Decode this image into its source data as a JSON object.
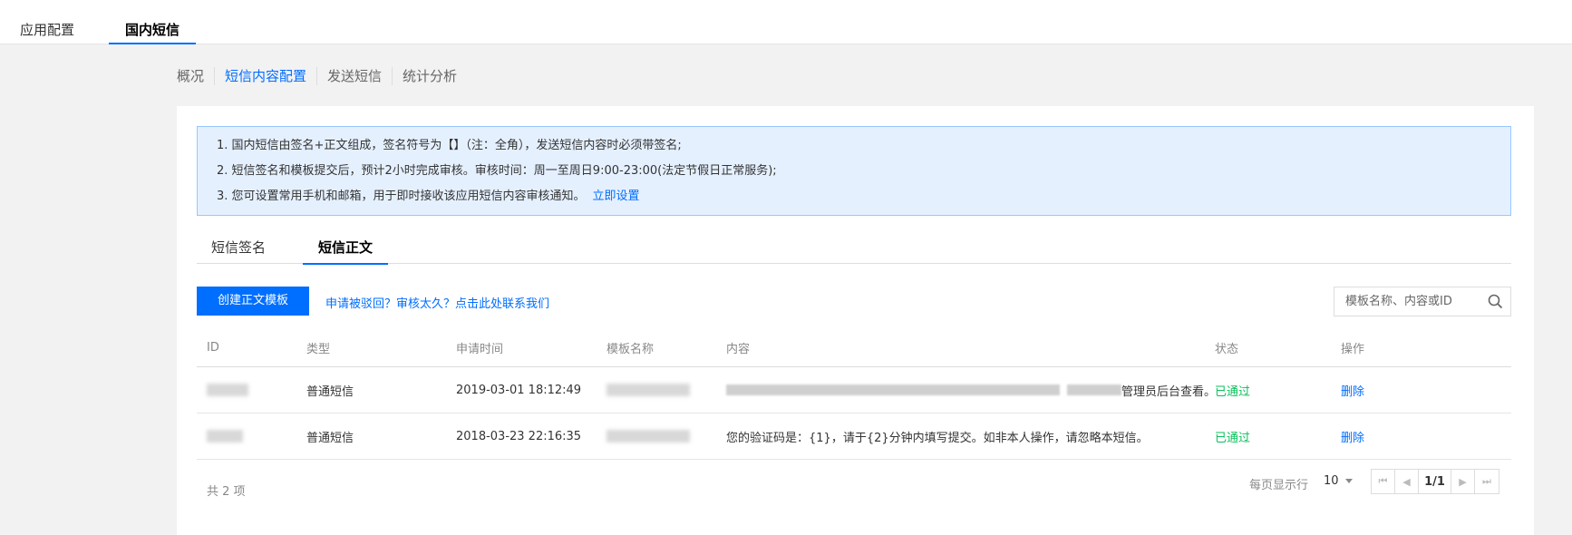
{
  "top_tabs": [
    "应用配置",
    "国内短信"
  ],
  "sub_nav": [
    "概况",
    "短信内容配置",
    "发送短信",
    "统计分析"
  ],
  "notice": {
    "line1": "1. 国内短信由签名+正文组成，签名符号为【】（注：全角），发送短信内容时必须带签名;",
    "line2": "2. 短信签名和模板提交后，预计2小时完成审核。审核时间：周一至周日9:00-23:00(法定节假日正常服务);",
    "line3": "3. 您可设置常用手机和邮箱，用于即时接收该应用短信内容审核通知。",
    "link": "立即设置"
  },
  "inner_tabs": [
    "短信签名",
    "短信正文"
  ],
  "toolbar": {
    "create_label": "创建正文模板",
    "help_link": "申请被驳回？审核太久？点击此处联系我们",
    "search_placeholder": "模板名称、内容或ID"
  },
  "table": {
    "headers": [
      "ID",
      "类型",
      "申请时间",
      "模板名称",
      "内容",
      "状态",
      "操作"
    ],
    "rows": [
      {
        "type": "普通短信",
        "time": "2019-03-01 18:12:49",
        "content_tail": "管理员后台查看。",
        "status": "已通过",
        "op": "删除"
      },
      {
        "type": "普通短信",
        "time": "2018-03-23 22:16:35",
        "content": "您的验证码是：{1}，请于{2}分钟内填写提交。如非本人操作，请忽略本短信。",
        "status": "已通过",
        "op": "删除"
      }
    ]
  },
  "footer": {
    "total": "共 2 项",
    "per_page_label": "每页显示行",
    "page_size": "10",
    "page_indicator": "1/1"
  },
  "colors": {
    "accent": "#006eff",
    "success": "#0abf5b",
    "notice_bg": "#e5f0ff"
  }
}
